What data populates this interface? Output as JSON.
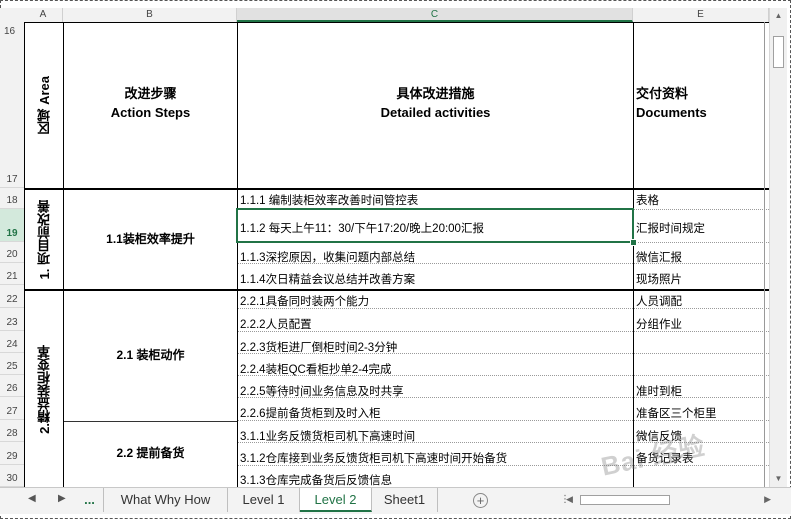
{
  "columns": [
    "A",
    "B",
    "C",
    "E"
  ],
  "rows": [
    "16",
    "17",
    "18",
    "19",
    "20",
    "21",
    "22",
    "23",
    "24",
    "25",
    "26",
    "27",
    "28",
    "29",
    "30"
  ],
  "selected_row": "19",
  "header": {
    "area_cn": "区域",
    "area_en": "Area",
    "steps_cn": "改进步骤",
    "steps_en": "Action Steps",
    "activities_cn": "具体改进措施",
    "activities_en": "Detailed activities",
    "docs_cn": "交付资料",
    "docs_en": "Documents"
  },
  "areas": [
    {
      "label": "1. 项目前改善"
    },
    {
      "label": "2.精益装柜变革"
    }
  ],
  "steps": [
    {
      "label": "1.1装柜效率提升"
    },
    {
      "label": "2.1 装柜动作"
    },
    {
      "label": "2.2 提前备货"
    }
  ],
  "activities": [
    {
      "row": "18",
      "text": "1.1.1 编制装柜效率改善时间管控表",
      "doc": "表格"
    },
    {
      "row": "19",
      "text": "1.1.2 每天上午11：30/下午17:20/晚上20:00汇报",
      "doc": "汇报时间规定"
    },
    {
      "row": "20",
      "text": "1.1.3深挖原因，收集问题内部总结",
      "doc": "微信汇报"
    },
    {
      "row": "21",
      "text": "1.1.4次日精益会议总结并改善方案",
      "doc": "现场照片"
    },
    {
      "row": "22",
      "text": "2.2.1具备同时装两个能力",
      "doc": "人员调配"
    },
    {
      "row": "23",
      "text": "2.2.2人员配置",
      "doc": "分组作业"
    },
    {
      "row": "24",
      "text": "2.2.3货柜进厂倒柜时间2-3分钟",
      "doc": ""
    },
    {
      "row": "25",
      "text": "2.2.4装柜QC看柜抄单2-4完成",
      "doc": ""
    },
    {
      "row": "26",
      "text": "2.2.5等待时间业务信息及时共享",
      "doc": "准时到柜"
    },
    {
      "row": "27",
      "text": "2.2.6提前备货柜到及时入柜",
      "doc": "准备区三个柜里"
    },
    {
      "row": "28",
      "text": "3.1.1业务反馈货柜司机下高速时间",
      "doc": "微信反馈"
    },
    {
      "row": "29",
      "text": "3.1.2仓库接到业务反馈货柜司机下高速时间开始备货",
      "doc": "备货记录表"
    },
    {
      "row": "30",
      "text": "3.1.3仓库完成备货后反馈信息",
      "doc": ""
    }
  ],
  "tabs": {
    "more": "...",
    "items": [
      "What Why How",
      "Level 1",
      "Level 2",
      "Sheet1"
    ],
    "active": "Level 2"
  },
  "watermark": "Bai 经验",
  "colors": {
    "accent": "#217346"
  }
}
